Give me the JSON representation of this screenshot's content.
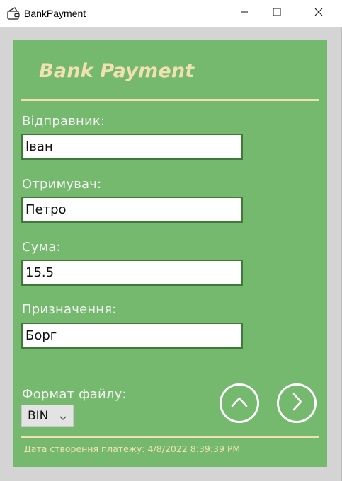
{
  "window": {
    "title": "BankPayment",
    "icons": {
      "app": "wallet-icon",
      "minimize": "minimize-icon",
      "maximize": "maximize-icon",
      "close": "close-icon"
    }
  },
  "header": {
    "title": "Bank Payment"
  },
  "form": {
    "sender": {
      "label": "Відправник:",
      "value": "Іван"
    },
    "recipient": {
      "label": "Отримувач:",
      "value": "Петро"
    },
    "amount": {
      "label": "Сума:",
      "value": "15.5"
    },
    "purpose": {
      "label": "Призначення:",
      "value": "Борг"
    },
    "file_format": {
      "label": "Формат файлу:",
      "selected": "BIN"
    }
  },
  "actions": {
    "up_icon": "chevron-up-icon",
    "next_icon": "chevron-right-icon"
  },
  "footer": {
    "created_at": "Дата створення платежу: 4/8/2022 8:39:39 PM"
  },
  "colors": {
    "panel": "#75b96e",
    "accent": "#f2e1b0",
    "input_border": "#3f7a3b",
    "label": "#f4f4f4"
  }
}
